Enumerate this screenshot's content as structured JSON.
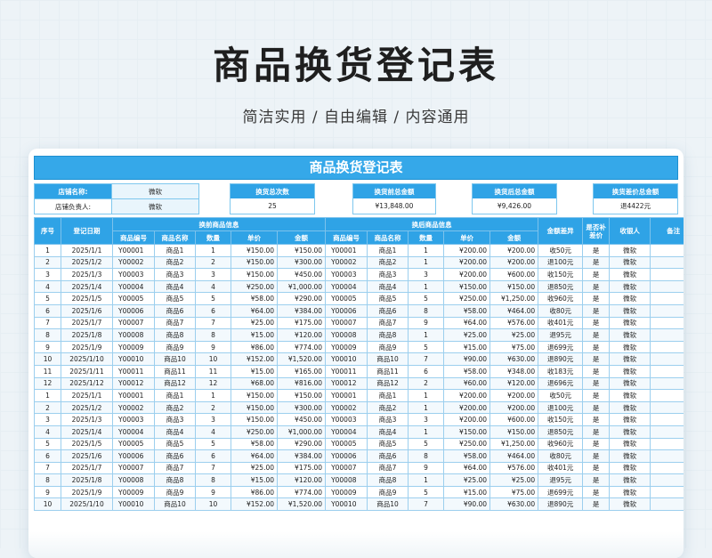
{
  "hero": {
    "title": "商品换货登记表",
    "subtitle": "简洁实用 / 自由编辑 / 内容通用"
  },
  "sheet": {
    "banner": "商品换货登记表",
    "store_name_label": "店铺名称:",
    "store_name_value": "微软",
    "store_manager_label": "店铺负责人:",
    "store_manager_value": "微软",
    "summary": [
      {
        "label": "换货总次数",
        "value": "25"
      },
      {
        "label": "换货前总金额",
        "value": "¥13,848.00"
      },
      {
        "label": "换货后总金额",
        "value": "¥9,426.00"
      },
      {
        "label": "换货差价总金额",
        "value": "退4422元"
      }
    ],
    "headers": {
      "seq": "序号",
      "date": "登记日期",
      "before_group": "换前商品信息",
      "after_group": "换后商品信息",
      "code": "商品编号",
      "name": "商品名称",
      "qty": "数量",
      "price": "单价",
      "amount": "金额",
      "diff": "金额差异",
      "paid": "是否补差价",
      "receiver": "收银人",
      "note": "备注"
    },
    "rows": [
      {
        "seq": "1",
        "date": "2025/1/1",
        "bcode": "Y00001",
        "bname": "商品1",
        "bqty": "1",
        "bprice": "¥150.00",
        "bamt": "¥150.00",
        "acode": "Y00001",
        "aname": "商品1",
        "aqty": "1",
        "aprice": "¥200.00",
        "aamt": "¥200.00",
        "diff": "收50元",
        "paid": "是",
        "recv": "微软",
        "note": ""
      },
      {
        "seq": "2",
        "date": "2025/1/2",
        "bcode": "Y00002",
        "bname": "商品2",
        "bqty": "2",
        "bprice": "¥150.00",
        "bamt": "¥300.00",
        "acode": "Y00002",
        "aname": "商品2",
        "aqty": "1",
        "aprice": "¥200.00",
        "aamt": "¥200.00",
        "diff": "退100元",
        "paid": "是",
        "recv": "微软",
        "note": ""
      },
      {
        "seq": "3",
        "date": "2025/1/3",
        "bcode": "Y00003",
        "bname": "商品3",
        "bqty": "3",
        "bprice": "¥150.00",
        "bamt": "¥450.00",
        "acode": "Y00003",
        "aname": "商品3",
        "aqty": "3",
        "aprice": "¥200.00",
        "aamt": "¥600.00",
        "diff": "收150元",
        "paid": "是",
        "recv": "微软",
        "note": ""
      },
      {
        "seq": "4",
        "date": "2025/1/4",
        "bcode": "Y00004",
        "bname": "商品4",
        "bqty": "4",
        "bprice": "¥250.00",
        "bamt": "¥1,000.00",
        "acode": "Y00004",
        "aname": "商品4",
        "aqty": "1",
        "aprice": "¥150.00",
        "aamt": "¥150.00",
        "diff": "退850元",
        "paid": "是",
        "recv": "微软",
        "note": ""
      },
      {
        "seq": "5",
        "date": "2025/1/5",
        "bcode": "Y00005",
        "bname": "商品5",
        "bqty": "5",
        "bprice": "¥58.00",
        "bamt": "¥290.00",
        "acode": "Y00005",
        "aname": "商品5",
        "aqty": "5",
        "aprice": "¥250.00",
        "aamt": "¥1,250.00",
        "diff": "收960元",
        "paid": "是",
        "recv": "微软",
        "note": ""
      },
      {
        "seq": "6",
        "date": "2025/1/6",
        "bcode": "Y00006",
        "bname": "商品6",
        "bqty": "6",
        "bprice": "¥64.00",
        "bamt": "¥384.00",
        "acode": "Y00006",
        "aname": "商品6",
        "aqty": "8",
        "aprice": "¥58.00",
        "aamt": "¥464.00",
        "diff": "收80元",
        "paid": "是",
        "recv": "微软",
        "note": ""
      },
      {
        "seq": "7",
        "date": "2025/1/7",
        "bcode": "Y00007",
        "bname": "商品7",
        "bqty": "7",
        "bprice": "¥25.00",
        "bamt": "¥175.00",
        "acode": "Y00007",
        "aname": "商品7",
        "aqty": "9",
        "aprice": "¥64.00",
        "aamt": "¥576.00",
        "diff": "收401元",
        "paid": "是",
        "recv": "微软",
        "note": ""
      },
      {
        "seq": "8",
        "date": "2025/1/8",
        "bcode": "Y00008",
        "bname": "商品8",
        "bqty": "8",
        "bprice": "¥15.00",
        "bamt": "¥120.00",
        "acode": "Y00008",
        "aname": "商品8",
        "aqty": "1",
        "aprice": "¥25.00",
        "aamt": "¥25.00",
        "diff": "退95元",
        "paid": "是",
        "recv": "微软",
        "note": ""
      },
      {
        "seq": "9",
        "date": "2025/1/9",
        "bcode": "Y00009",
        "bname": "商品9",
        "bqty": "9",
        "bprice": "¥86.00",
        "bamt": "¥774.00",
        "acode": "Y00009",
        "aname": "商品9",
        "aqty": "5",
        "aprice": "¥15.00",
        "aamt": "¥75.00",
        "diff": "退699元",
        "paid": "是",
        "recv": "微软",
        "note": ""
      },
      {
        "seq": "10",
        "date": "2025/1/10",
        "bcode": "Y00010",
        "bname": "商品10",
        "bqty": "10",
        "bprice": "¥152.00",
        "bamt": "¥1,520.00",
        "acode": "Y00010",
        "aname": "商品10",
        "aqty": "7",
        "aprice": "¥90.00",
        "aamt": "¥630.00",
        "diff": "退890元",
        "paid": "是",
        "recv": "微软",
        "note": ""
      },
      {
        "seq": "11",
        "date": "2025/1/11",
        "bcode": "Y00011",
        "bname": "商品11",
        "bqty": "11",
        "bprice": "¥15.00",
        "bamt": "¥165.00",
        "acode": "Y00011",
        "aname": "商品11",
        "aqty": "6",
        "aprice": "¥58.00",
        "aamt": "¥348.00",
        "diff": "收183元",
        "paid": "是",
        "recv": "微软",
        "note": ""
      },
      {
        "seq": "12",
        "date": "2025/1/12",
        "bcode": "Y00012",
        "bname": "商品12",
        "bqty": "12",
        "bprice": "¥68.00",
        "bamt": "¥816.00",
        "acode": "Y00012",
        "aname": "商品12",
        "aqty": "2",
        "aprice": "¥60.00",
        "aamt": "¥120.00",
        "diff": "退696元",
        "paid": "是",
        "recv": "微软",
        "note": ""
      },
      {
        "seq": "1",
        "date": "2025/1/1",
        "bcode": "Y00001",
        "bname": "商品1",
        "bqty": "1",
        "bprice": "¥150.00",
        "bamt": "¥150.00",
        "acode": "Y00001",
        "aname": "商品1",
        "aqty": "1",
        "aprice": "¥200.00",
        "aamt": "¥200.00",
        "diff": "收50元",
        "paid": "是",
        "recv": "微软",
        "note": ""
      },
      {
        "seq": "2",
        "date": "2025/1/2",
        "bcode": "Y00002",
        "bname": "商品2",
        "bqty": "2",
        "bprice": "¥150.00",
        "bamt": "¥300.00",
        "acode": "Y00002",
        "aname": "商品2",
        "aqty": "1",
        "aprice": "¥200.00",
        "aamt": "¥200.00",
        "diff": "退100元",
        "paid": "是",
        "recv": "微软",
        "note": ""
      },
      {
        "seq": "3",
        "date": "2025/1/3",
        "bcode": "Y00003",
        "bname": "商品3",
        "bqty": "3",
        "bprice": "¥150.00",
        "bamt": "¥450.00",
        "acode": "Y00003",
        "aname": "商品3",
        "aqty": "3",
        "aprice": "¥200.00",
        "aamt": "¥600.00",
        "diff": "收150元",
        "paid": "是",
        "recv": "微软",
        "note": ""
      },
      {
        "seq": "4",
        "date": "2025/1/4",
        "bcode": "Y00004",
        "bname": "商品4",
        "bqty": "4",
        "bprice": "¥250.00",
        "bamt": "¥1,000.00",
        "acode": "Y00004",
        "aname": "商品4",
        "aqty": "1",
        "aprice": "¥150.00",
        "aamt": "¥150.00",
        "diff": "退850元",
        "paid": "是",
        "recv": "微软",
        "note": ""
      },
      {
        "seq": "5",
        "date": "2025/1/5",
        "bcode": "Y00005",
        "bname": "商品5",
        "bqty": "5",
        "bprice": "¥58.00",
        "bamt": "¥290.00",
        "acode": "Y00005",
        "aname": "商品5",
        "aqty": "5",
        "aprice": "¥250.00",
        "aamt": "¥1,250.00",
        "diff": "收960元",
        "paid": "是",
        "recv": "微软",
        "note": ""
      },
      {
        "seq": "6",
        "date": "2025/1/6",
        "bcode": "Y00006",
        "bname": "商品6",
        "bqty": "6",
        "bprice": "¥64.00",
        "bamt": "¥384.00",
        "acode": "Y00006",
        "aname": "商品6",
        "aqty": "8",
        "aprice": "¥58.00",
        "aamt": "¥464.00",
        "diff": "收80元",
        "paid": "是",
        "recv": "微软",
        "note": ""
      },
      {
        "seq": "7",
        "date": "2025/1/7",
        "bcode": "Y00007",
        "bname": "商品7",
        "bqty": "7",
        "bprice": "¥25.00",
        "bamt": "¥175.00",
        "acode": "Y00007",
        "aname": "商品7",
        "aqty": "9",
        "aprice": "¥64.00",
        "aamt": "¥576.00",
        "diff": "收401元",
        "paid": "是",
        "recv": "微软",
        "note": ""
      },
      {
        "seq": "8",
        "date": "2025/1/8",
        "bcode": "Y00008",
        "bname": "商品8",
        "bqty": "8",
        "bprice": "¥15.00",
        "bamt": "¥120.00",
        "acode": "Y00008",
        "aname": "商品8",
        "aqty": "1",
        "aprice": "¥25.00",
        "aamt": "¥25.00",
        "diff": "退95元",
        "paid": "是",
        "recv": "微软",
        "note": ""
      },
      {
        "seq": "9",
        "date": "2025/1/9",
        "bcode": "Y00009",
        "bname": "商品9",
        "bqty": "9",
        "bprice": "¥86.00",
        "bamt": "¥774.00",
        "acode": "Y00009",
        "aname": "商品9",
        "aqty": "5",
        "aprice": "¥15.00",
        "aamt": "¥75.00",
        "diff": "退699元",
        "paid": "是",
        "recv": "微软",
        "note": ""
      },
      {
        "seq": "10",
        "date": "2025/1/10",
        "bcode": "Y00010",
        "bname": "商品10",
        "bqty": "10",
        "bprice": "¥152.00",
        "bamt": "¥1,520.00",
        "acode": "Y00010",
        "aname": "商品10",
        "aqty": "7",
        "aprice": "¥90.00",
        "aamt": "¥630.00",
        "diff": "退890元",
        "paid": "是",
        "recv": "微软",
        "note": ""
      }
    ]
  }
}
